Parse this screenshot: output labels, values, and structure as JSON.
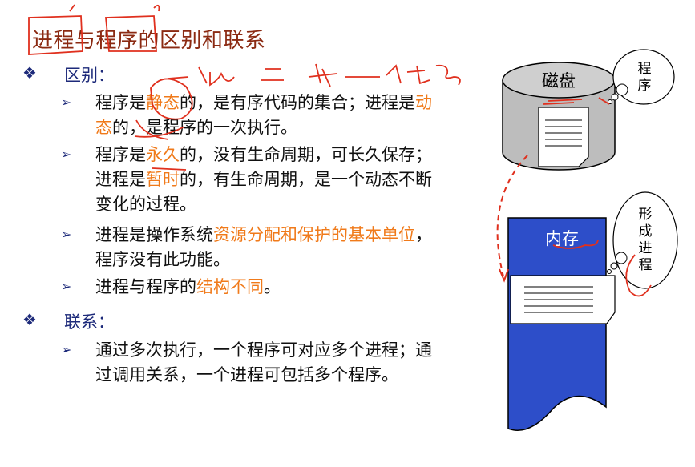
{
  "title": "进程与程序的区别和联系",
  "sections": {
    "diff_label": "区别：",
    "relation_label": "联系："
  },
  "bullets": {
    "b1": {
      "p1": "程序是",
      "h1": "静态",
      "p2": "的，是有序代码的集合；进程是",
      "h2": "动态",
      "p3": "的，是程序的一次执行。"
    },
    "b2": {
      "p1": "程序是",
      "h1": "永久",
      "p2": "的，没有生命周期，可长久保存；进程是",
      "h2": "暂时",
      "p3": "的，有生命周期，是一个动态不断变化的过程。"
    },
    "b3": {
      "p1": "进程是操作系统",
      "h1": "资源分配和保护的基本单位",
      "p2": "，程序没有此功能。"
    },
    "b4": {
      "p1": "进程与程序的",
      "h1": "结构不同",
      "p2": "。"
    },
    "b5": {
      "p1": "通过多次执行，一个程序可对应多个进程；通过调用关系，一个进程可包括多个程序。"
    }
  },
  "diagram": {
    "disk_label": "磁盘",
    "memory_label": "内存",
    "cloud1": [
      "程",
      "序"
    ],
    "cloud2": [
      "形",
      "成",
      "进",
      "程"
    ]
  },
  "colors": {
    "title": "#8B2A12",
    "bullet": "#1d2a7a",
    "highlight": "#f07a1a",
    "memory": "#2d4ec9",
    "disk": "#bdbdbd",
    "annotation": "#e0301e"
  }
}
